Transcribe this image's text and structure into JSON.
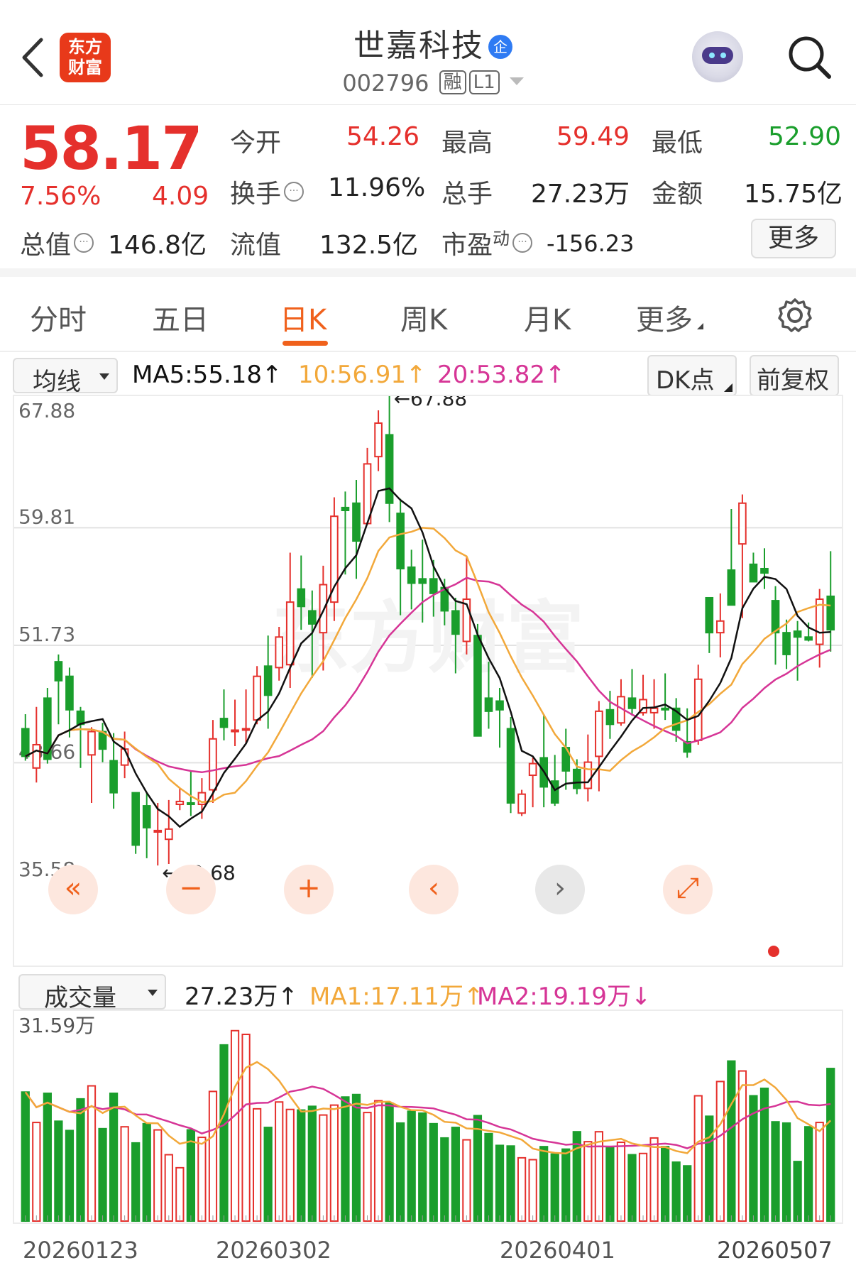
{
  "header": {
    "logo_line1": "东方",
    "logo_line2": "财富",
    "stock_name": "世嘉科技",
    "name_badge": "企",
    "stock_code": "002796",
    "tag_margin": "融",
    "tag_level": "L1"
  },
  "quote": {
    "price": "58.17",
    "change_pct": "7.56%",
    "change_amt": "4.09",
    "open_label": "今开",
    "open_value": "54.26",
    "high_label": "最高",
    "high_value": "59.49",
    "low_label": "最低",
    "low_value": "52.90",
    "turnover_label": "换手",
    "turnover_value": "11.96%",
    "volume_label": "总手",
    "volume_value": "27.23万",
    "amount_label": "金额",
    "amount_value": "15.75亿",
    "mktcap_label": "总值",
    "mktcap_value": "146.8亿",
    "float_label": "流值",
    "float_value": "132.5亿",
    "pe_label": "市盈",
    "pe_super": "动",
    "pe_value": "-156.23",
    "more_label": "更多"
  },
  "tabs": [
    "分时",
    "五日",
    "日K",
    "周K",
    "月K",
    "更多"
  ],
  "active_tab": "日K",
  "ma_bar": {
    "selector": "均线",
    "ma5": "MA5:55.18↑",
    "ma10": "10:56.91↑",
    "ma20": "20:53.82↑",
    "dk_button": "DK点",
    "fq_button": "前复权"
  },
  "vol_bar": {
    "selector": "成交量",
    "vol": "27.23万↑",
    "ma1": "MA1:17.11万↑",
    "ma2": "MA2:19.19万↓"
  },
  "colors": {
    "up": "#e5302c",
    "down": "#1a9e2c",
    "ma5": "#111111",
    "ma10": "#f2a83a",
    "ma20": "#d63596",
    "accent": "#f0611c"
  },
  "controls": [
    "double-left-icon",
    "zoom-out-icon",
    "zoom-in-icon",
    "prev-icon",
    "next-icon",
    "fullscreen-icon"
  ],
  "chart_data": [
    {
      "type": "candlestick",
      "y_ticks": [
        "67.88",
        "59.81",
        "51.73",
        "43.66",
        "35.58"
      ],
      "ylim": [
        35.58,
        67.88
      ],
      "max_label": "←67.88",
      "min_label": "←40.68",
      "x_ticks": [
        "20260123",
        "20260302",
        "20260401"
      ],
      "x_tick_partial": "20260507",
      "candles": [
        [
          46.0,
          44.1,
          47.0,
          43.8
        ],
        [
          43.3,
          44.9,
          47.5,
          42.3
        ],
        [
          48.1,
          43.9,
          48.8,
          43.6
        ],
        [
          50.6,
          49.3,
          51.1,
          46.3
        ],
        [
          49.6,
          47.3,
          50.2,
          45.4
        ],
        [
          47.2,
          46.3,
          47.5,
          43.3
        ],
        [
          44.2,
          45.8,
          46.1,
          40.9
        ],
        [
          45.8,
          44.6,
          46.4,
          43.7
        ],
        [
          43.8,
          41.6,
          45.7,
          40.5
        ],
        [
          43.5,
          44.6,
          45.8,
          42.6
        ],
        [
          41.6,
          38.0,
          41.6,
          37.4
        ],
        [
          40.7,
          39.2,
          41.6,
          37.1
        ],
        [
          38.9,
          39.0,
          40.9,
          36.6
        ],
        [
          38.4,
          39.1,
          41.1,
          36.7
        ],
        [
          40.8,
          41.0,
          41.9,
          40.4
        ],
        [
          40.9,
          40.8,
          43.1,
          40.0
        ],
        [
          40.8,
          41.6,
          42.6,
          39.8
        ],
        [
          41.8,
          45.3,
          46.6,
          40.9
        ],
        [
          46.7,
          46.1,
          48.7,
          45.2
        ],
        [
          45.8,
          45.9,
          48.0,
          44.8
        ],
        [
          46.0,
          46.0,
          48.7,
          45.0
        ],
        [
          46.6,
          49.6,
          50.3,
          46.3
        ],
        [
          50.3,
          48.3,
          52.4,
          46.0
        ],
        [
          50.2,
          52.3,
          53.0,
          49.3
        ],
        [
          50.4,
          54.7,
          58.1,
          48.8
        ],
        [
          55.6,
          54.4,
          57.9,
          52.8
        ],
        [
          54.1,
          53.2,
          55.5,
          49.5
        ],
        [
          52.6,
          55.9,
          57.2,
          50.0
        ],
        [
          54.7,
          60.6,
          61.9,
          53.4
        ],
        [
          61.2,
          61.0,
          62.3,
          56.6
        ],
        [
          61.5,
          58.9,
          63.1,
          56.3
        ],
        [
          60.1,
          64.2,
          65.3,
          60.0
        ],
        [
          64.7,
          67.0,
          67.88,
          63.7
        ],
        [
          66.2,
          61.5,
          68.9,
          60.2
        ],
        [
          60.8,
          57.0,
          61.8,
          53.8
        ],
        [
          57.1,
          56.0,
          58.3,
          54.2
        ],
        [
          56.3,
          56.0,
          59.0,
          53.3
        ],
        [
          56.3,
          55.3,
          57.6,
          53.7
        ],
        [
          55.7,
          54.1,
          56.3,
          53.1
        ],
        [
          54.1,
          52.5,
          55.0,
          49.8
        ],
        [
          52.0,
          54.9,
          57.8,
          51.1
        ],
        [
          52.4,
          45.5,
          53.2,
          45.5
        ],
        [
          48.1,
          47.2,
          50.6,
          46.0
        ],
        [
          47.9,
          47.3,
          48.8,
          44.7
        ],
        [
          46.0,
          40.9,
          46.8,
          40.2
        ],
        [
          40.2,
          41.5,
          41.8,
          40.0
        ],
        [
          42.8,
          43.6,
          44.0,
          40.6
        ],
        [
          44.0,
          42.0,
          47.0,
          40.6
        ],
        [
          42.4,
          40.9,
          44.2,
          40.7
        ],
        [
          44.7,
          43.1,
          46.0,
          41.8
        ],
        [
          43.2,
          41.9,
          43.9,
          41.5
        ],
        [
          41.9,
          43.7,
          45.6,
          41.0
        ],
        [
          44.1,
          47.2,
          47.9,
          41.7
        ],
        [
          47.3,
          46.3,
          48.6,
          45.3
        ],
        [
          46.4,
          48.2,
          49.4,
          46.2
        ],
        [
          48.1,
          47.4,
          50.1,
          46.9
        ],
        [
          47.1,
          48.0,
          49.7,
          46.9
        ],
        [
          47.1,
          47.4,
          49.4,
          46.0
        ],
        [
          47.4,
          47.3,
          49.8,
          46.6
        ],
        [
          47.4,
          45.9,
          48.1,
          45.1
        ],
        [
          45.1,
          44.4,
          47.4,
          44.0
        ],
        [
          45.2,
          49.4,
          50.4,
          44.9
        ],
        [
          55.0,
          52.6,
          55.0,
          51.2
        ],
        [
          52.6,
          53.4,
          55.3,
          50.9
        ],
        [
          56.9,
          54.5,
          61.1,
          56.0
        ],
        [
          58.7,
          61.5,
          62.1,
          53.6
        ],
        [
          57.3,
          56.1,
          58.1,
          56.1
        ],
        [
          57.0,
          56.7,
          58.4,
          55.6
        ],
        [
          54.8,
          52.6,
          55.8,
          50.4
        ],
        [
          52.6,
          51.1,
          53.5,
          50.1
        ],
        [
          52.7,
          52.3,
          53.4,
          49.3
        ],
        [
          52.3,
          52.1,
          53.3,
          52.0
        ],
        [
          51.8,
          54.9,
          55.6,
          50.2
        ],
        [
          55.1,
          52.8,
          58.2,
          51.3
        ]
      ]
    },
    {
      "type": "bar",
      "title": "成交量",
      "y_tick": "31.59万",
      "values": [
        20.8,
        15.9,
        20.6,
        16.1,
        14.6,
        19.7,
        21.8,
        14.9,
        20.6,
        15.2,
        12.6,
        15.7,
        14.7,
        10.7,
        8.6,
        14.7,
        13.5,
        20.9,
        28.4,
        30.7,
        30.1,
        18.1,
        15.1,
        19.2,
        18.0,
        17.9,
        18.5,
        17.1,
        18.7,
        20.0,
        20.4,
        17.5,
        19.4,
        19.0,
        15.8,
        17.7,
        17.4,
        15.7,
        13.4,
        15.1,
        13.1,
        17.0,
        14.1,
        12.2,
        12.1,
        10.2,
        9.9,
        12.0,
        10.8,
        11.6,
        14.4,
        12.8,
        14.4,
        12.0,
        12.7,
        10.7,
        10.9,
        13.4,
        12.0,
        9.5,
        8.9,
        20.2,
        16.9,
        22.5,
        25.8,
        24.2,
        20.2,
        21.4,
        16.0,
        15.8,
        9.6,
        15.2,
        15.9,
        24.6
      ],
      "colors": "up/down per candle",
      "ma1": "MA1:17.11万↑",
      "ma2": "MA2:19.19万↓"
    }
  ]
}
